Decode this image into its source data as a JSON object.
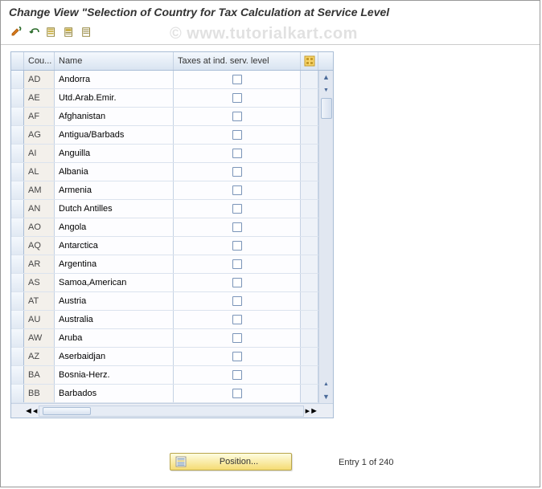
{
  "title": "Change View \"Selection of Country for Tax Calculation at Service Level",
  "watermark": "© www.tutorialkart.com",
  "columns": {
    "code": "Cou...",
    "name": "Name",
    "tax": "Taxes at ind. serv. level"
  },
  "rows": [
    {
      "code": "AD",
      "name": "Andorra",
      "checked": false
    },
    {
      "code": "AE",
      "name": "Utd.Arab.Emir.",
      "checked": false
    },
    {
      "code": "AF",
      "name": "Afghanistan",
      "checked": false
    },
    {
      "code": "AG",
      "name": "Antigua/Barbads",
      "checked": false
    },
    {
      "code": "AI",
      "name": "Anguilla",
      "checked": false
    },
    {
      "code": "AL",
      "name": "Albania",
      "checked": false
    },
    {
      "code": "AM",
      "name": "Armenia",
      "checked": false
    },
    {
      "code": "AN",
      "name": "Dutch Antilles",
      "checked": false
    },
    {
      "code": "AO",
      "name": "Angola",
      "checked": false
    },
    {
      "code": "AQ",
      "name": "Antarctica",
      "checked": false
    },
    {
      "code": "AR",
      "name": "Argentina",
      "checked": false
    },
    {
      "code": "AS",
      "name": "Samoa,American",
      "checked": false
    },
    {
      "code": "AT",
      "name": "Austria",
      "checked": false
    },
    {
      "code": "AU",
      "name": "Australia",
      "checked": false
    },
    {
      "code": "AW",
      "name": "Aruba",
      "checked": false
    },
    {
      "code": "AZ",
      "name": "Aserbaidjan",
      "checked": false
    },
    {
      "code": "BA",
      "name": "Bosnia-Herz.",
      "checked": false
    },
    {
      "code": "BB",
      "name": "Barbados",
      "checked": false
    }
  ],
  "position_button": "Position...",
  "entry_status": "Entry 1 of 240"
}
